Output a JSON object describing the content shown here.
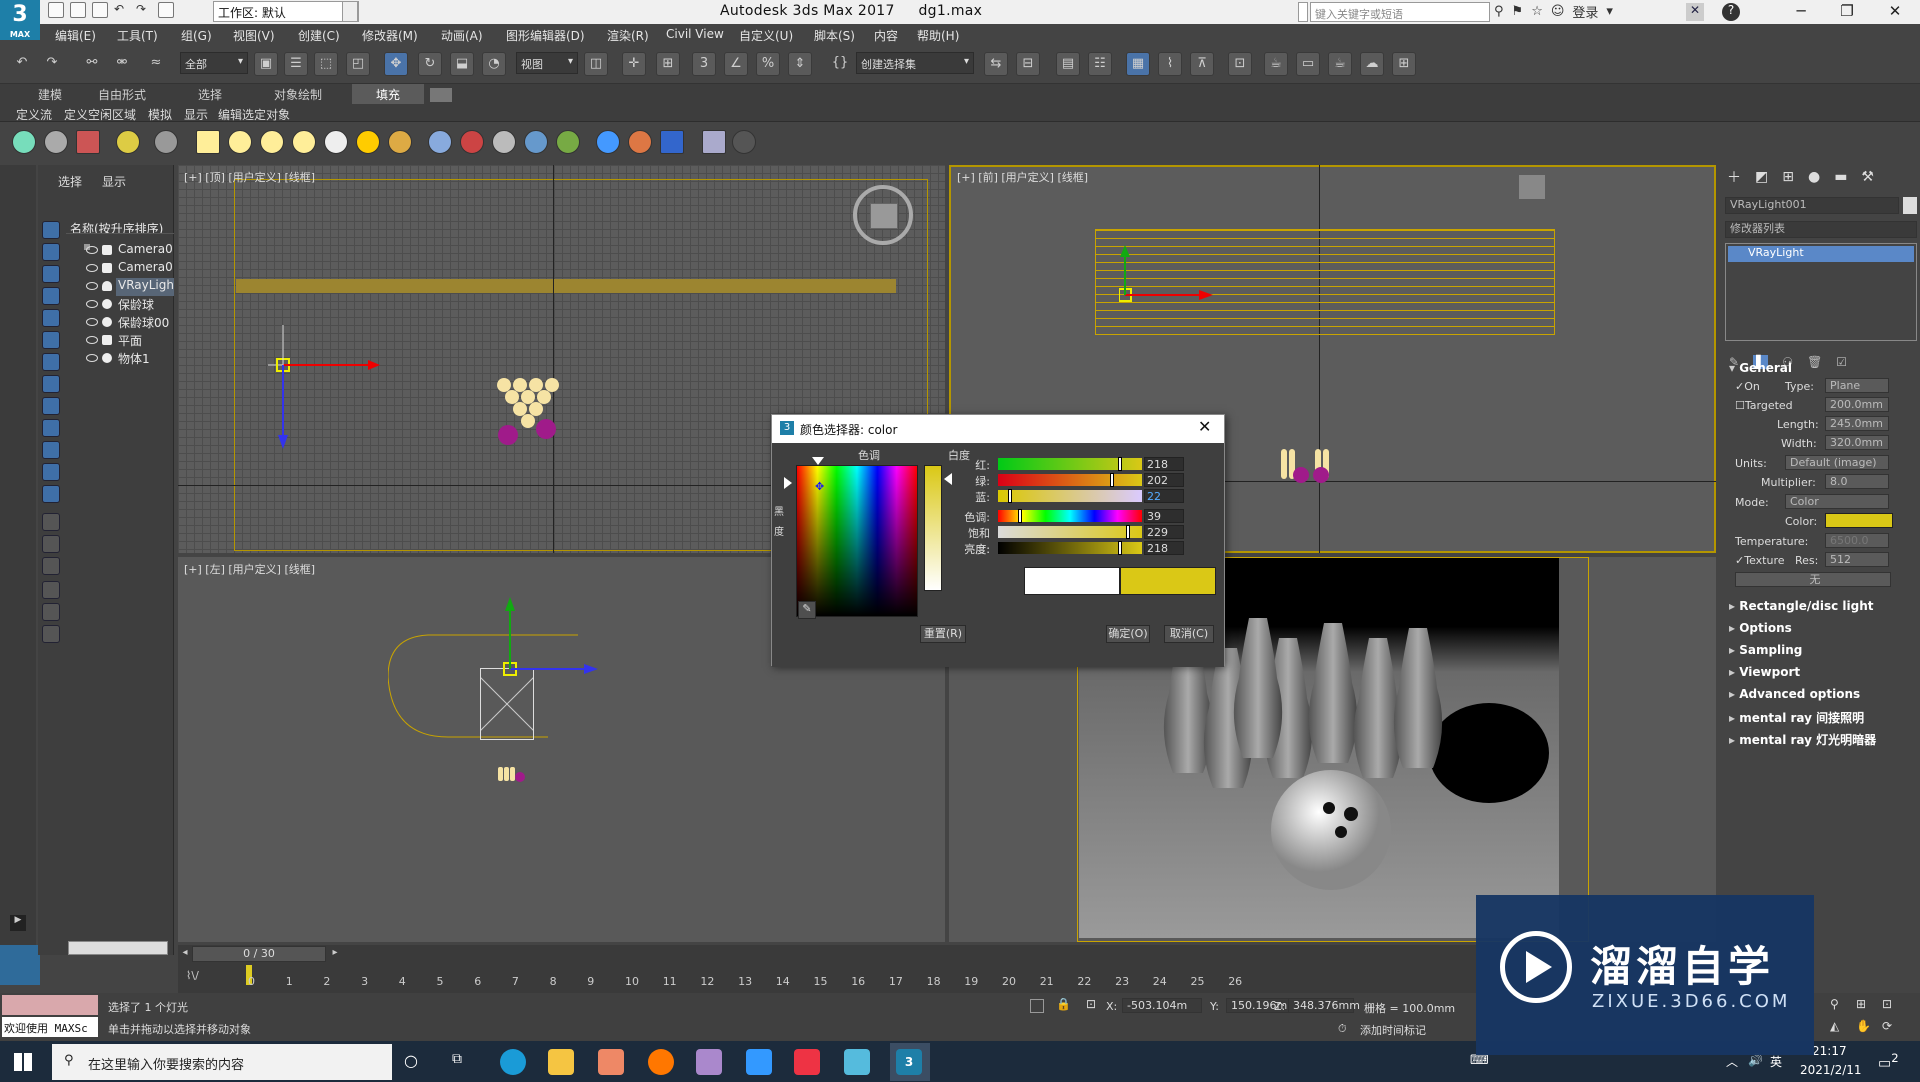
{
  "titlebar": {
    "logo_text": "3",
    "logo_sub": "MAX",
    "workspace": "工作区: 默认",
    "app_name": "Autodesk 3ds Max 2017",
    "file_name": "dg1.max",
    "search_placeholder": "键入关键字或短语",
    "login": "登录"
  },
  "menu": [
    "编辑(E)",
    "工具(T)",
    "组(G)",
    "视图(V)",
    "创建(C)",
    "修改器(M)",
    "动画(A)",
    "图形编辑器(D)",
    "渲染(R)",
    "Civil View",
    "自定义(U)",
    "脚本(S)",
    "内容",
    "帮助(H)"
  ],
  "toolbar": {
    "filter": "全部",
    "ref_coord": "视图",
    "selection_set": "创建选择集"
  },
  "ribbon_tabs": [
    "建模",
    "自由形式",
    "选择",
    "对象绘制",
    "填充"
  ],
  "ribbon_sub": [
    "定义流",
    "定义空闲区域",
    "模拟",
    "显示",
    "编辑选定对象"
  ],
  "scene_explorer": {
    "tabs": [
      "选择",
      "显示"
    ],
    "header": "名称(按升序排序)",
    "items": [
      "Camera0",
      "Camera0",
      "VRayLigh",
      "保龄球",
      "保龄球00",
      "平面",
      "物体1"
    ]
  },
  "viewports": {
    "top_left": "[+] [顶] [用户定义] [线框]",
    "top_right": "[+] [前] [用户定义] [线框]",
    "bottom_left": "[+] [左] [用户定义] [线框]"
  },
  "color_picker": {
    "title": "颜色选择器: color",
    "hue_label": "色调",
    "white_label": "白度",
    "black_label": "黑",
    "degree_label": "度",
    "rows": [
      {
        "label": "红:",
        "value": "218"
      },
      {
        "label": "绿:",
        "value": "202"
      },
      {
        "label": "蓝:",
        "value": "22"
      },
      {
        "label": "色调:",
        "value": "39"
      },
      {
        "label": "饱和度:",
        "value": "229"
      },
      {
        "label": "亮度:",
        "value": "218"
      }
    ],
    "reset": "重置(R)",
    "ok": "确定(O)",
    "cancel": "取消(C)",
    "current_color": "#dac816"
  },
  "command_panel": {
    "object_name": "VRayLight001",
    "modifier_list": "修改器列表",
    "stack_item": "VRayLight",
    "general": "General",
    "on_label": "On",
    "type_label": "Type:",
    "type_value": "Plane",
    "targeted": "Targeted",
    "targeted_value": "200.0mm",
    "length_label": "Length:",
    "length_value": "245.0mm",
    "width_label": "Width:",
    "width_value": "320.0mm",
    "units_label": "Units:",
    "units_value": "Default (image)",
    "multiplier_label": "Multiplier:",
    "multiplier_value": "8.0",
    "mode_label": "Mode:",
    "mode_value": "Color",
    "color_label": "Color:",
    "temperature_label": "Temperature:",
    "temperature_value": "6500.0",
    "texture_label": "Texture",
    "res_label": "Res:",
    "res_value": "512",
    "none_label": "无",
    "rollouts": [
      "Rectangle/disc light",
      "Options",
      "Sampling",
      "Viewport",
      "Advanced options",
      "mental ray 间接照明",
      "mental ray 灯光明暗器"
    ]
  },
  "timeline": {
    "frame": "0 / 30",
    "ticks": [
      "0",
      "1",
      "2",
      "3",
      "4",
      "5",
      "6",
      "7",
      "8",
      "9",
      "10",
      "11",
      "12",
      "13",
      "14",
      "15",
      "16",
      "17",
      "18",
      "19",
      "20",
      "21",
      "22",
      "23",
      "24",
      "25",
      "26"
    ]
  },
  "status": {
    "welcome": "欢迎使用 MAXSc",
    "selected": "选择了 1 个灯光",
    "hint": "单击并拖动以选择并移动对象",
    "x_label": "X:",
    "x_value": "-503.104m",
    "y_label": "Y:",
    "y_value": "150.196mm",
    "z_label": "Z:",
    "z_value": "348.376mm",
    "grid": "栅格 = 100.0mm",
    "add_tag": "添加时间标记"
  },
  "taskbar": {
    "search": "在这里输入你要搜索的内容",
    "time": "21:17",
    "date": "2021/2/11",
    "notif": "2"
  },
  "watermark": {
    "text": "溜溜自学",
    "url": "ZIXUE.3D66.COM"
  }
}
